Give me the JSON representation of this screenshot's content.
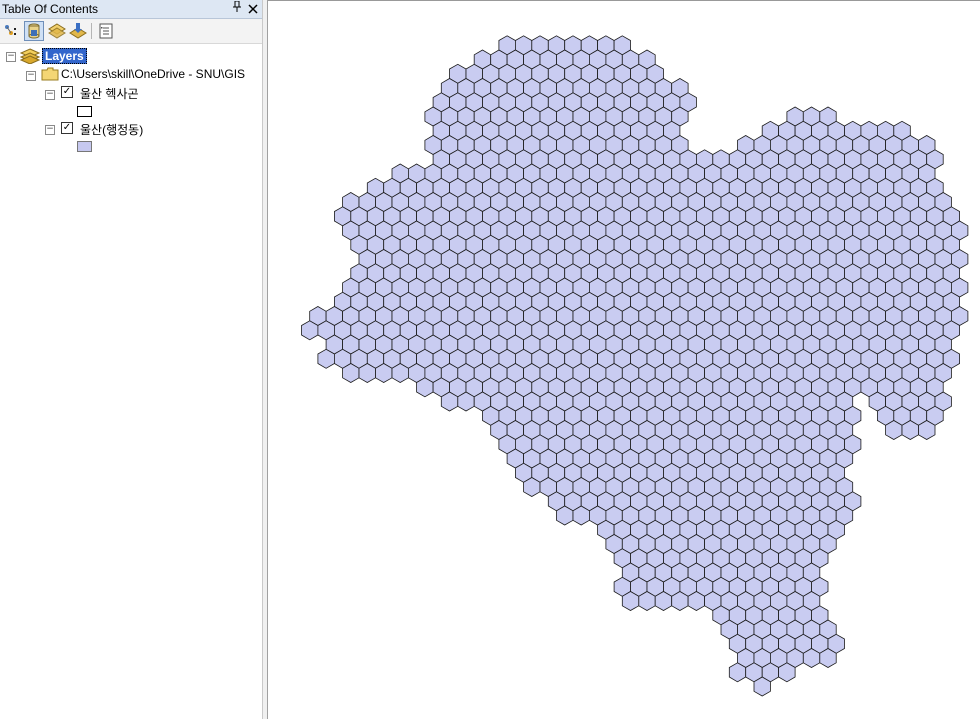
{
  "toc": {
    "title": "Table Of Contents",
    "pin_glyph": "ᵖ",
    "close_glyph": "✕",
    "toolbar": [
      {
        "icon": "list-by-drawing-order-icon"
      },
      {
        "icon": "list-by-source-icon"
      },
      {
        "icon": "list-by-visibility-icon"
      },
      {
        "icon": "list-by-selection-icon"
      },
      {
        "icon": "options-icon"
      }
    ],
    "root_label": "Layers",
    "folder_path": "C:\\Users\\skill\\OneDrive - SNU\\GIS",
    "layers": [
      {
        "name": "울산 헥사곤",
        "checked": true,
        "symbol_fill": "#ffffff"
      },
      {
        "name": "울산(행정동)",
        "checked": true,
        "symbol_fill": "#c6c8ef"
      }
    ]
  },
  "map": {
    "hex_fill": "#c9ccf1",
    "hex_stroke": "#1a1a1a"
  }
}
